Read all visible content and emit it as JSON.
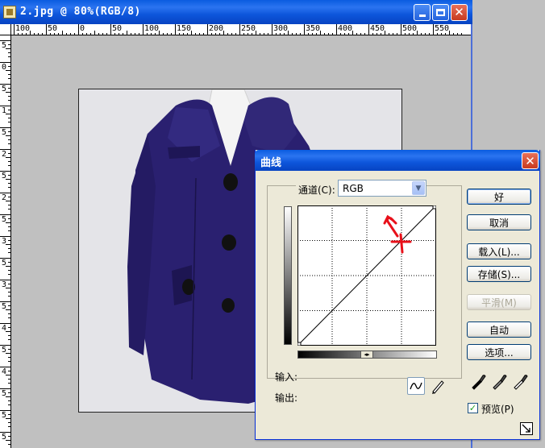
{
  "document": {
    "title": "2.jpg @ 80%(RGB/8)",
    "ruler_top_labels": [
      "100",
      "50",
      "0",
      "50",
      "100",
      "150",
      "200",
      "250",
      "300",
      "350",
      "400",
      "450",
      "500",
      "550"
    ],
    "ruler_left_labels": [
      "5",
      "0",
      "5",
      "1",
      "5",
      "2",
      "5",
      "2",
      "5",
      "3",
      "5",
      "3",
      "5",
      "4",
      "5",
      "4",
      "5",
      "5",
      "5"
    ]
  },
  "curves_dialog": {
    "title": "曲线",
    "channel_label": "通道(C):",
    "channel_value": "RGB",
    "input_label": "输入:",
    "output_label": "输出:",
    "buttons": {
      "ok": "好",
      "cancel": "取消",
      "load": "载入(L)...",
      "save": "存储(S)...",
      "smooth": "平滑(M)",
      "auto": "自动",
      "options": "选项..."
    },
    "preview_label": "预览(P)",
    "preview_checked": true
  },
  "colors": {
    "titlebar_blue": "#0d56db",
    "dialog_bg": "#ece9d8",
    "coat": "#2a2070",
    "annotation": "#e8101a"
  },
  "icons": [
    "photoshop-doc-icon",
    "minimize-icon",
    "maximize-icon",
    "close-icon",
    "dropdown-arrow-icon",
    "curve-tool-icon",
    "pencil-tool-icon",
    "black-eyedropper-icon",
    "gray-eyedropper-icon",
    "white-eyedropper-icon",
    "expand-dialog-icon"
  ]
}
